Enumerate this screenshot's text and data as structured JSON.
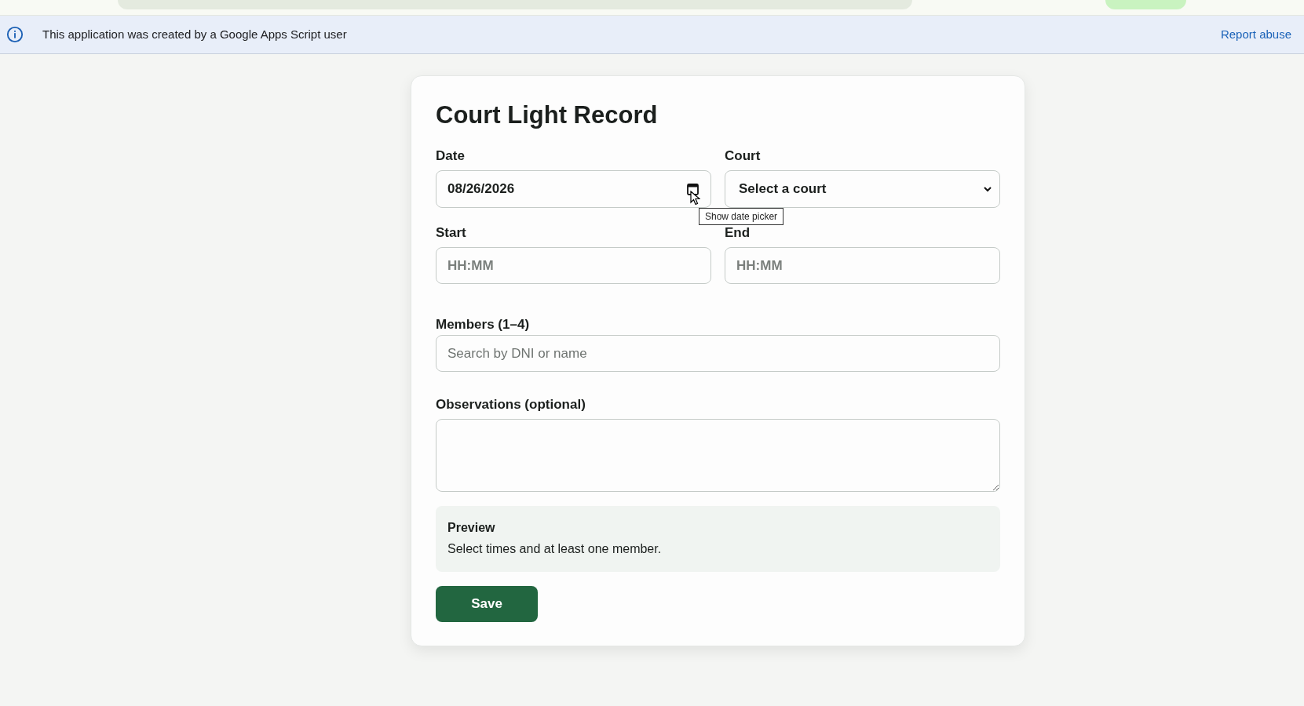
{
  "banner": {
    "message": "This application was created by a Google Apps Script user",
    "link": "Report abuse"
  },
  "form": {
    "title": "Court Light Record",
    "date": {
      "label": "Date",
      "value": "08/26/2026",
      "tooltip": "Show date picker"
    },
    "court": {
      "label": "Court",
      "value": "Select a court"
    },
    "start": {
      "label": "Start",
      "placeholder": "HH:MM"
    },
    "end": {
      "label": "End",
      "placeholder": "HH:MM"
    },
    "members": {
      "label": "Members (1–4)",
      "placeholder": "Search by DNI or name"
    },
    "observations": {
      "label": "Observations (optional)"
    },
    "preview": {
      "title": "Preview",
      "text": "Select times and at least one member."
    },
    "save": "Save"
  }
}
